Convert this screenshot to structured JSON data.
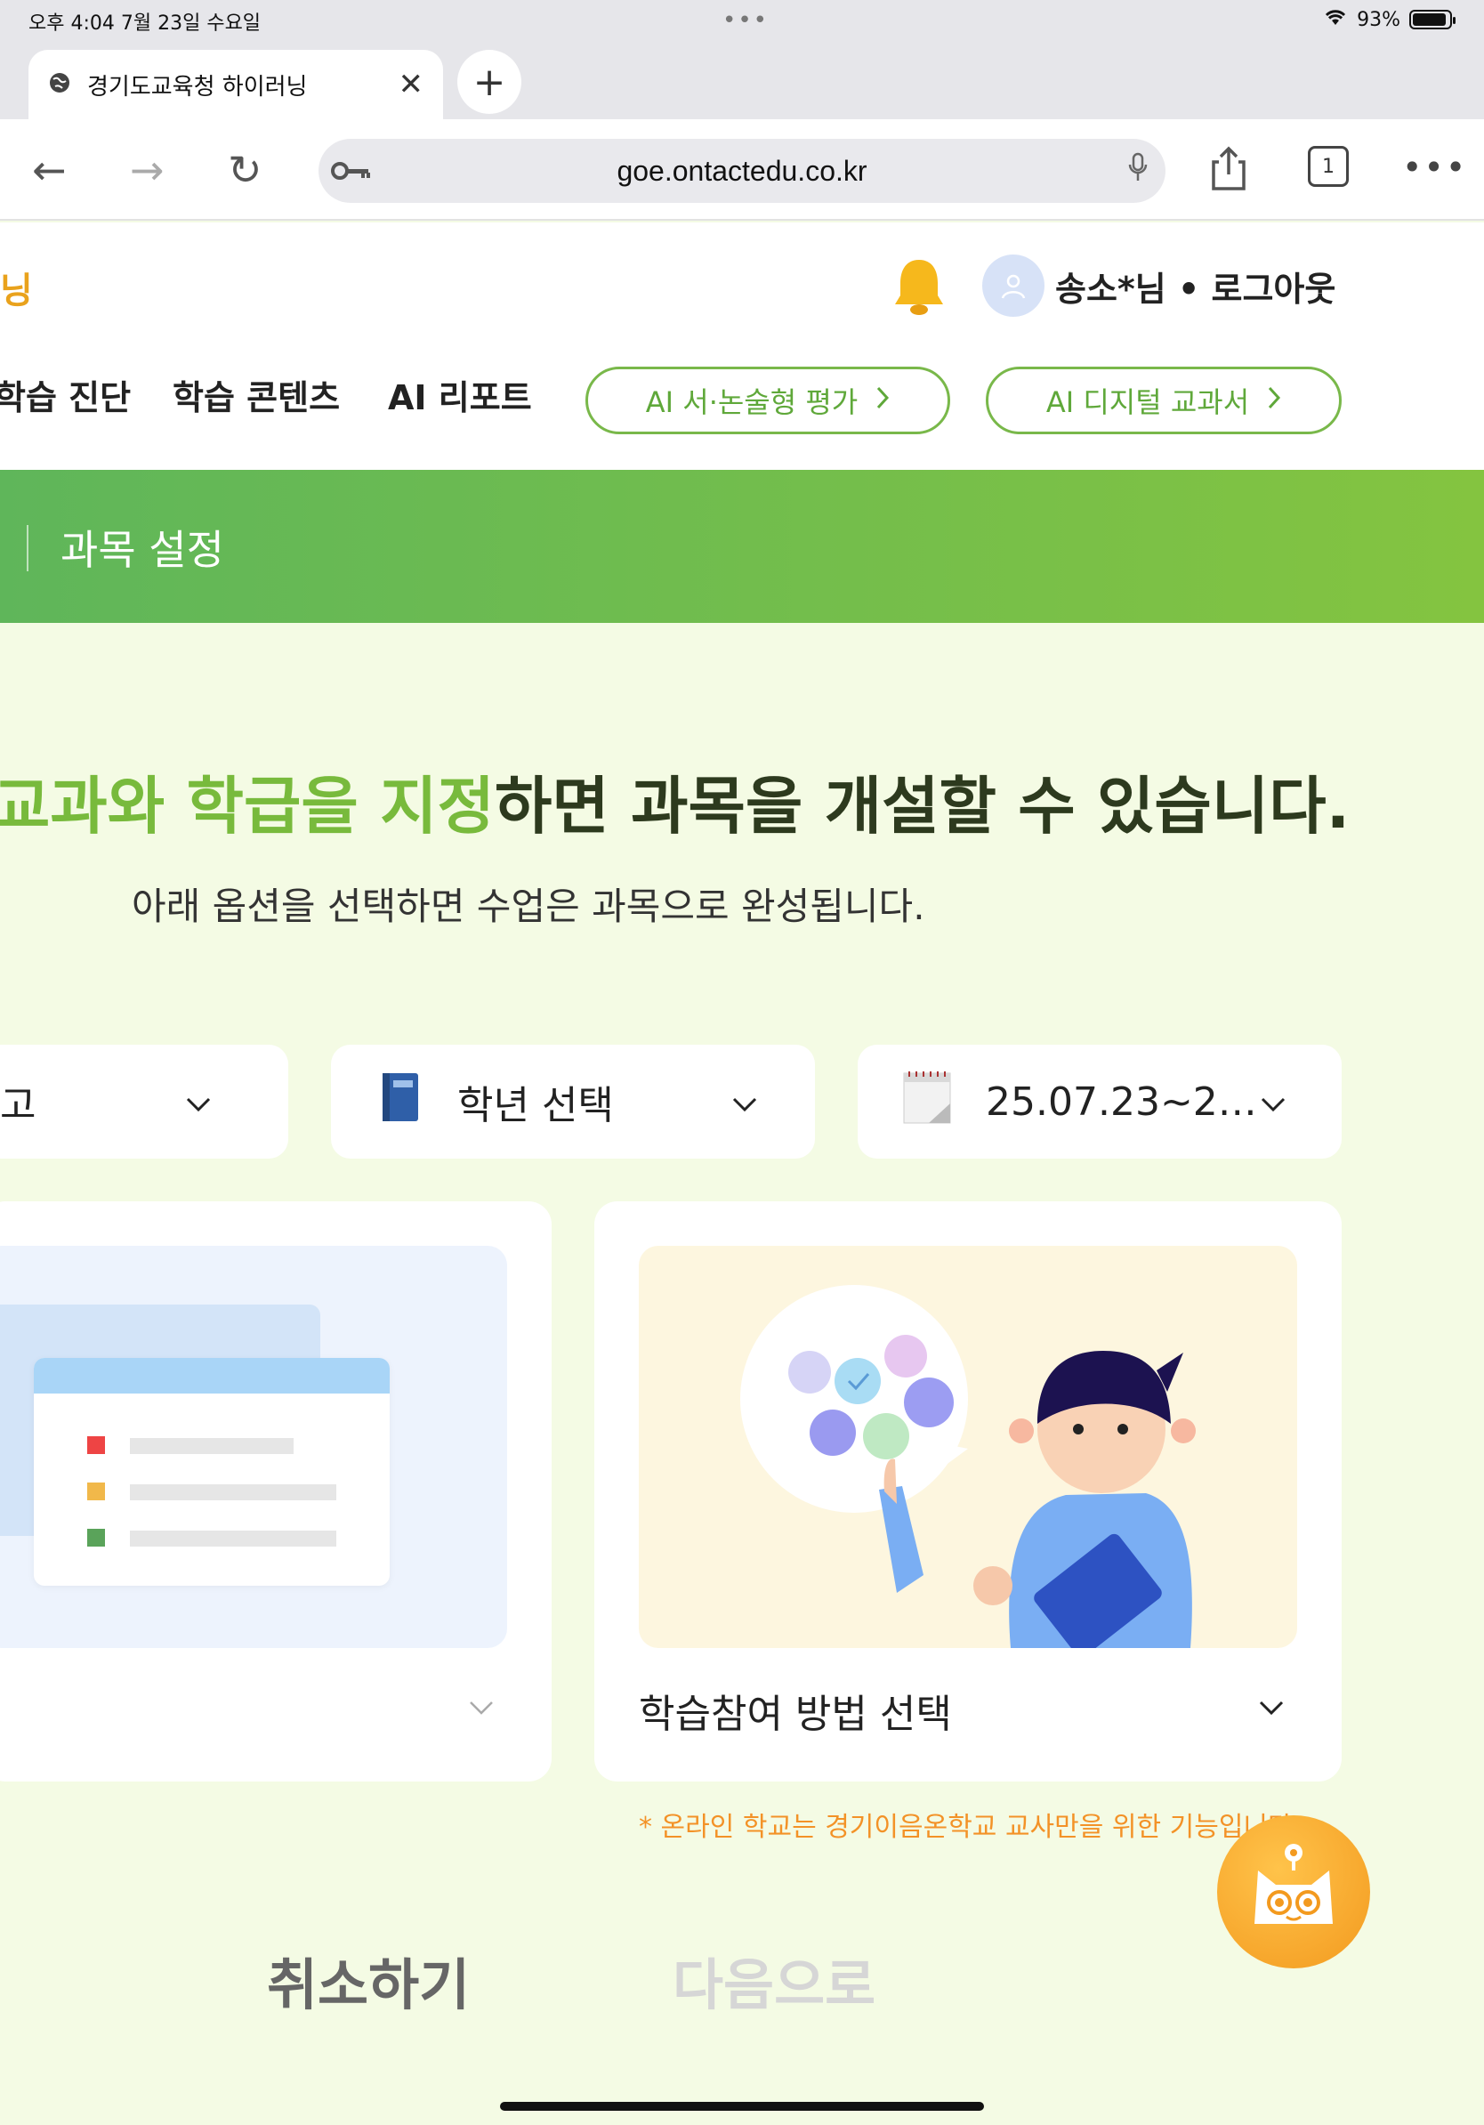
{
  "status_bar": {
    "time_date": "오후 4:04   7월 23일 수요일",
    "battery": "93%",
    "battery_level": 0.93
  },
  "browser": {
    "tab_title": "경기도교육청 하이러닝",
    "url": "goe.ontactedu.co.kr",
    "tab_count": "1",
    "icons": [
      "globe-icon",
      "close-icon",
      "plus-icon",
      "back-icon",
      "forward-icon",
      "reload-icon",
      "key-icon",
      "mic-icon",
      "share-icon",
      "tabs-icon",
      "more-icon",
      "wifi-icon",
      "battery-icon"
    ]
  },
  "header": {
    "logo_fragment": "닝",
    "user": "송소*님 • 로그아웃",
    "nav": [
      "학습 진단",
      "학습 콘텐츠",
      "AI 리포트"
    ],
    "pill_1": "AI 서·논술형 평가",
    "pill_2": "AI 디지털 교과서"
  },
  "banner": {
    "title": "과목 설정"
  },
  "main": {
    "headline_hl": "교과와 학급을 지정",
    "headline_rest": "하면 과목을 개설할 수 있습니다.",
    "subline": "아래 옵션을 선택하면 수업은 과목으로 완성됩니다.",
    "select_1": "고",
    "select_2": "학년 선택",
    "select_3": "25.07.23~2…",
    "card_right_label": "학습참여 방법 선택",
    "note": "* 온라인 학교는 경기이음온학교 교사만을 위한 기능입니다",
    "cancel": "취소하기",
    "next": "다음으로"
  },
  "colors": {
    "brand_green": "#78ba3c",
    "banner_start": "#5fb65a",
    "banner_end": "#84c440",
    "page_bg": "#f4fbe4",
    "note_orange": "#f39227"
  }
}
